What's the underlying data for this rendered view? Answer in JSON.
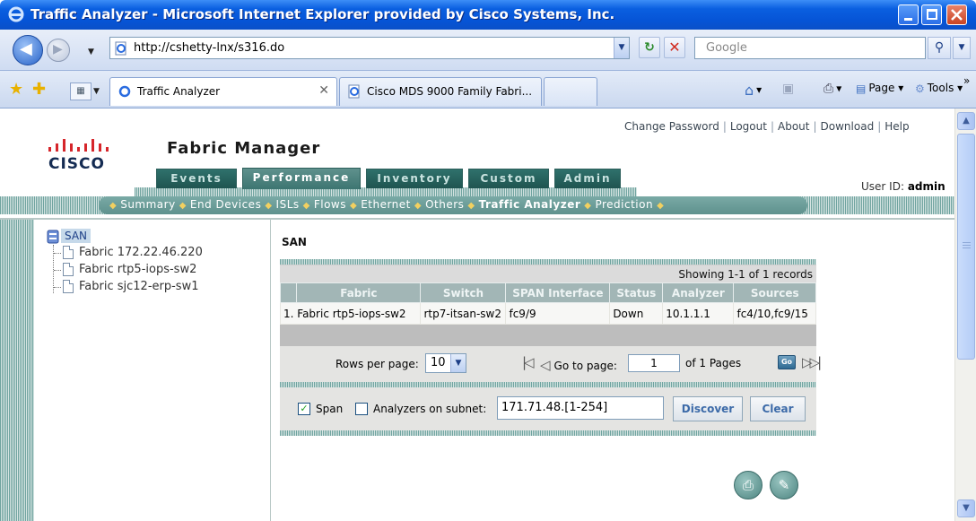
{
  "window": {
    "title": "Traffic Analyzer - Microsoft Internet Explorer provided by Cisco Systems, Inc."
  },
  "address": {
    "url": "http://cshetty-lnx/s316.do",
    "search_placeholder": "Google"
  },
  "browser_tabs": [
    {
      "label": "Traffic Analyzer",
      "active": true
    },
    {
      "label": "Cisco MDS 9000 Family Fabri...",
      "active": false
    }
  ],
  "commands": {
    "page": "Page",
    "tools": "Tools"
  },
  "header": {
    "logo_text": "CISCO",
    "app_title": "Fabric Manager",
    "links": [
      "Change Password",
      "Logout",
      "About",
      "Download",
      "Help"
    ],
    "user_id_label": "User ID:",
    "user_id": "admin"
  },
  "primary_tabs": [
    {
      "label": "Events",
      "active": false
    },
    {
      "label": "Performance",
      "active": true
    },
    {
      "label": "Inventory",
      "active": false
    },
    {
      "label": "Custom",
      "active": false
    },
    {
      "label": "Admin",
      "active": false
    }
  ],
  "sub_nav": [
    "Summary",
    "End Devices",
    "ISLs",
    "Flows",
    "Ethernet",
    "Others",
    "Traffic Analyzer",
    "Prediction"
  ],
  "sub_nav_current": "Traffic Analyzer",
  "tree": {
    "root": "SAN",
    "children": [
      "Fabric 172.22.46.220",
      "Fabric rtp5-iops-sw2",
      "Fabric sjc12-erp-sw1"
    ]
  },
  "main": {
    "title": "SAN",
    "showing": "Showing 1-1 of 1 records",
    "columns": [
      "Fabric",
      "Switch",
      "SPAN Interface",
      "Status",
      "Analyzer",
      "Sources"
    ],
    "rows": [
      {
        "num": "1.",
        "fabric": "Fabric rtp5-iops-sw2",
        "switch": "rtp7-itsan-sw2",
        "span": "fc9/9",
        "status": "Down",
        "analyzer": "10.1.1.1",
        "sources": "fc4/10,fc9/15"
      }
    ],
    "pager": {
      "rows_per_page_label": "Rows per page:",
      "rows_per_page": "10",
      "goto_label": "Go to page:",
      "page": "1",
      "of_pages": "of 1 Pages",
      "go": "Go"
    },
    "filter": {
      "span_label": "Span",
      "span_checked": true,
      "subnet_label": "Analyzers on subnet:",
      "subnet_checked": false,
      "subnet_value": "171.71.48.[1-254]",
      "discover": "Discover",
      "clear": "Clear"
    }
  },
  "colors": {
    "title_bar": "#0a5fe0",
    "tab_dark": "#1f5450",
    "subnav": "#6a9d99",
    "grid_header": "#a2b6b6",
    "logo_red": "#d6262b"
  }
}
